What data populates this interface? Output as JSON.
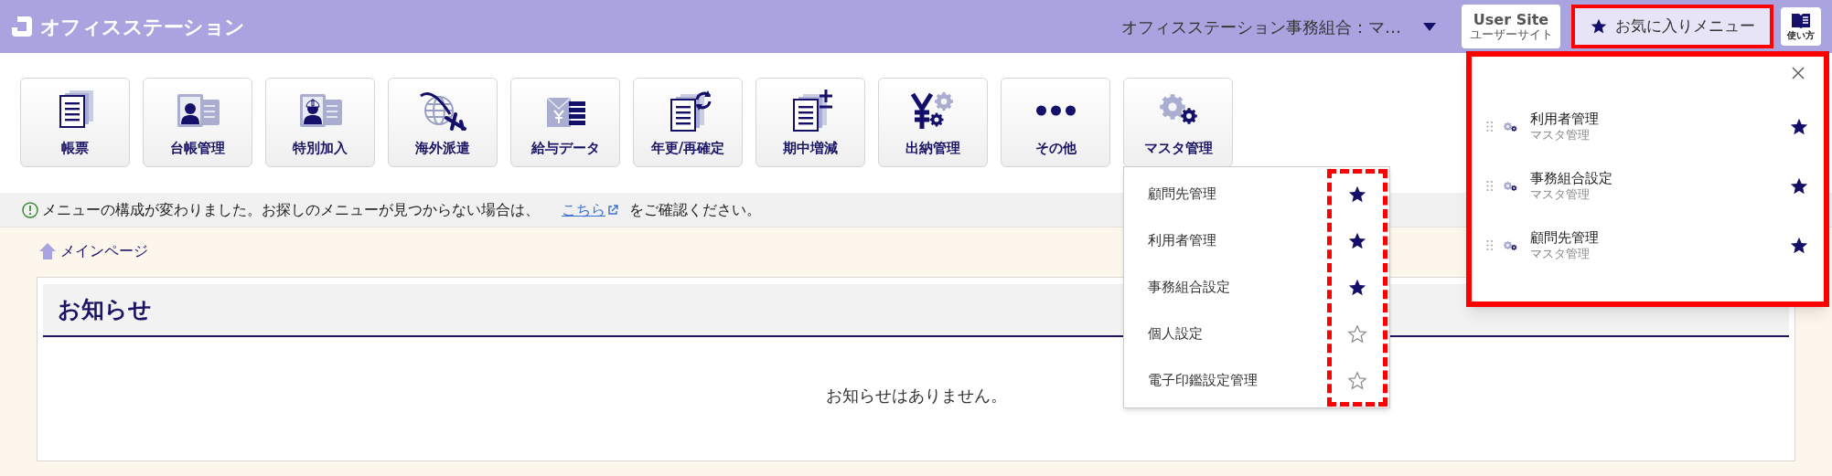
{
  "header": {
    "logo_text": "オフィスステーション",
    "account": "オフィスステーション事務組合：マ…",
    "user_site": {
      "label": "User Site",
      "sublabel": "ユーザーサイト"
    },
    "favorites_button": "お気に入りメニュー",
    "help": "使い方"
  },
  "menu_buttons": [
    {
      "label": "帳票",
      "kind": "document"
    },
    {
      "label": "台帳管理",
      "kind": "card"
    },
    {
      "label": "特別加入",
      "kind": "helmet-card"
    },
    {
      "label": "海外派遣",
      "kind": "globe"
    },
    {
      "label": "給与データ",
      "kind": "payslip"
    },
    {
      "label": "年更/再確定",
      "kind": "refresh"
    },
    {
      "label": "期中増減",
      "kind": "plusminus"
    },
    {
      "label": "出納管理",
      "kind": "yen"
    },
    {
      "label": "その他",
      "kind": "dots"
    },
    {
      "label": "マスタ管理",
      "kind": "gears"
    }
  ],
  "notice": {
    "text": "メニューの構成が変わりました。お探しのメニューが見つからない場合は、",
    "link": "こちら",
    "after": "をご確認ください。"
  },
  "breadcrumb": "メインページ",
  "news": {
    "title": "お知らせ",
    "empty": "お知らせはありません。"
  },
  "dropdown": {
    "items": [
      {
        "label": "顧問先管理",
        "favorite": true
      },
      {
        "label": "利用者管理",
        "favorite": true
      },
      {
        "label": "事務組合設定",
        "favorite": true
      },
      {
        "label": "個人設定",
        "favorite": false
      },
      {
        "label": "電子印鑑設定管理",
        "favorite": false
      }
    ]
  },
  "favorites_panel": {
    "items": [
      {
        "title": "利用者管理",
        "category": "マスタ管理",
        "favorite": true
      },
      {
        "title": "事務組合設定",
        "category": "マスタ管理",
        "favorite": true
      },
      {
        "title": "顧問先管理",
        "category": "マスタ管理",
        "favorite": true
      }
    ]
  }
}
